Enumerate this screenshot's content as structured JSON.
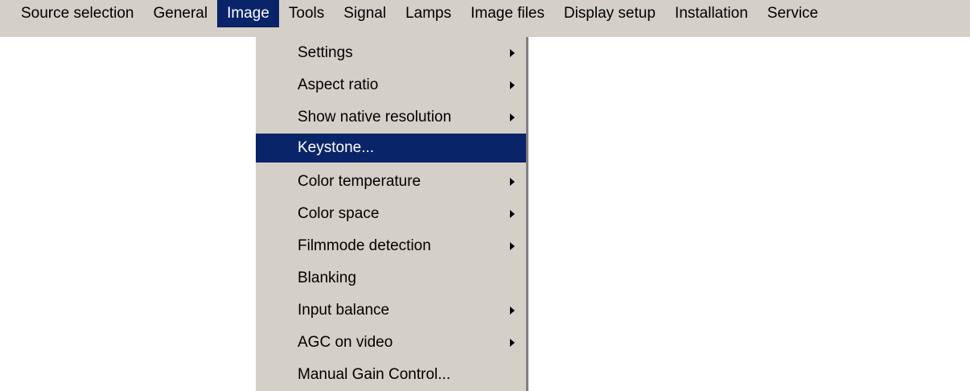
{
  "menubar": {
    "items": [
      {
        "label": "Source selection"
      },
      {
        "label": "General"
      },
      {
        "label": "Image"
      },
      {
        "label": "Tools"
      },
      {
        "label": "Signal"
      },
      {
        "label": "Lamps"
      },
      {
        "label": "Image files"
      },
      {
        "label": "Display setup"
      },
      {
        "label": "Installation"
      },
      {
        "label": "Service"
      }
    ],
    "active": "Image"
  },
  "image_menu": {
    "selected": "Keystone...",
    "items": [
      {
        "label": "Settings",
        "has_submenu": true
      },
      {
        "label": "Aspect ratio",
        "has_submenu": true
      },
      {
        "label": "Show native resolution",
        "has_submenu": true
      },
      {
        "label": "Keystone...",
        "has_submenu": false
      },
      {
        "label": "Color temperature",
        "has_submenu": true
      },
      {
        "label": "Color space",
        "has_submenu": true
      },
      {
        "label": "Filmmode detection",
        "has_submenu": true
      },
      {
        "label": "Blanking",
        "has_submenu": false
      },
      {
        "label": "Input balance",
        "has_submenu": true
      },
      {
        "label": "AGC on video",
        "has_submenu": true
      },
      {
        "label": "Manual Gain Control...",
        "has_submenu": false
      }
    ]
  },
  "colors": {
    "menu_background": "#d4d0c8",
    "highlight": "#0a246a",
    "highlight_text": "#ffffff"
  },
  "icons": {
    "submenu": "submenu-arrow-icon"
  }
}
